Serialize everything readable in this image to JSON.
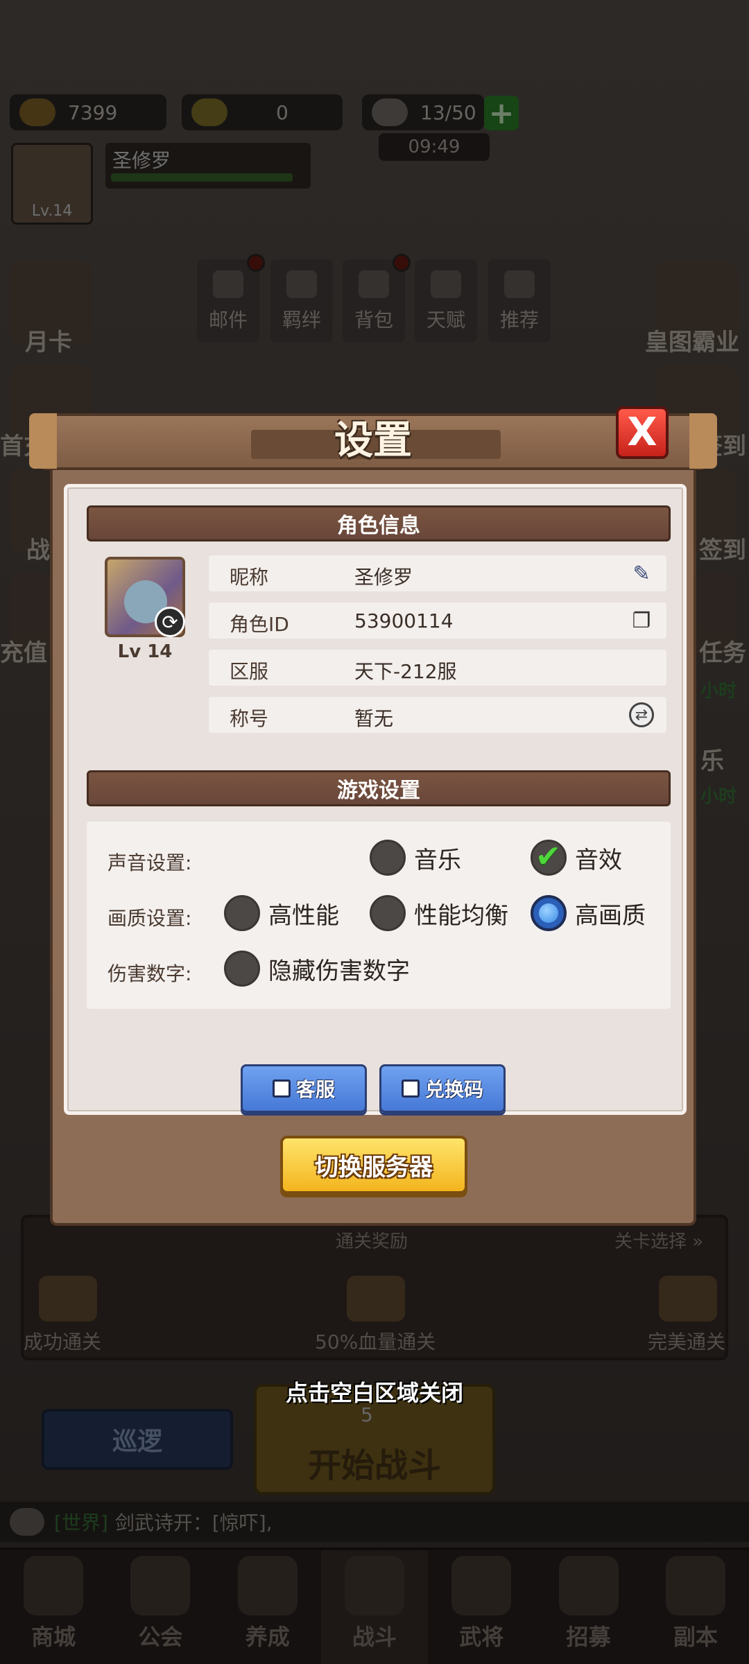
{
  "resources": {
    "gold": "7399",
    "tickets": "0",
    "stamina": "13/50",
    "timer": "09:49"
  },
  "player": {
    "name": "圣修罗",
    "level": "Lv.14"
  },
  "side_labels": {
    "month_card": "月卡",
    "first_charge": "首充",
    "battle": "战",
    "recharge": "充值",
    "emperor": "皇图霸业",
    "signin": "签到",
    "signin2": "签到",
    "task": "任务",
    "hour": "小时",
    "fun": "乐",
    "hour2": "小时"
  },
  "top_buttons": [
    "邮件",
    "羁绊",
    "背包",
    "天赋",
    "推荐"
  ],
  "rewards": {
    "title": "通关奖励",
    "select": "关卡选择",
    "items": [
      "成功通关",
      "50%血量通关",
      "完美通关"
    ]
  },
  "actions": {
    "patrol": "巡逻",
    "fight": "开始战斗",
    "fight_cost": "5"
  },
  "chat": {
    "channel": "[世界]",
    "text": "剑武诗开：[惊吓],"
  },
  "nav": [
    "商城",
    "公会",
    "养成",
    "战斗",
    "武将",
    "招募",
    "副本"
  ],
  "dialog": {
    "title": "设置",
    "close_label": "X",
    "role_section": "角色信息",
    "role_level": "Lv 14",
    "rows": [
      {
        "key": "昵称",
        "value": "圣修罗"
      },
      {
        "key": "角色ID",
        "value": "53900114"
      },
      {
        "key": "区服",
        "value": "天下-212服"
      },
      {
        "key": "称号",
        "value": "暂无"
      }
    ],
    "game_section": "游戏设置",
    "sound_label": "声音设置:",
    "sound_options": [
      "音乐",
      "音效"
    ],
    "quality_label": "画质设置:",
    "quality_options": [
      "高性能",
      "性能均衡",
      "高画质"
    ],
    "damage_label": "伤害数字:",
    "damage_option": "隐藏伤害数字",
    "service_button": "客服",
    "redeem_button": "兑换码",
    "switch_server_button": "切换服务器"
  },
  "dismiss_hint": "点击空白区域关闭"
}
